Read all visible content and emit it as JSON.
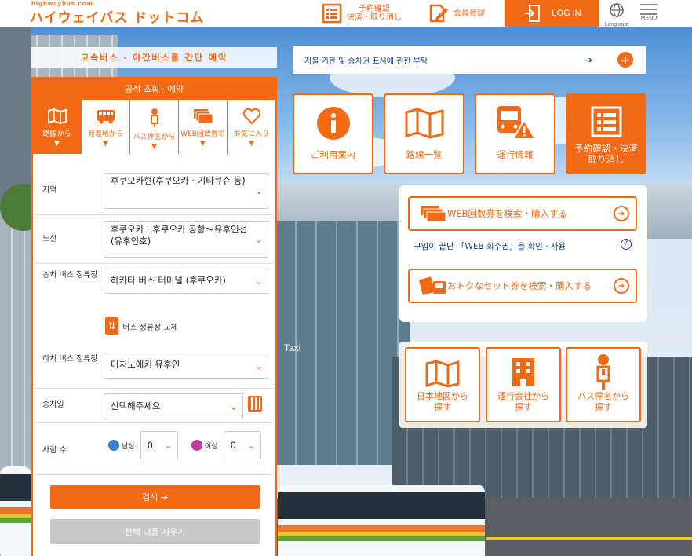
{
  "header": {
    "logo_url": "highwaybus.com",
    "logo_text": "ハイウェイバス ドットコム",
    "reservation_label_1": "予約確認",
    "reservation_label_2": "決済・取り消し",
    "member_label": "会員登録",
    "login_label": "LOG IN",
    "language_label": "Language",
    "menu_label": "MENU"
  },
  "catchphrase": "고속버스 · 야간버스를 간단 예약",
  "panel": {
    "title": "공석 조회 · 예약",
    "tabs": [
      {
        "label": "路線から",
        "icon": "map-icon",
        "active": true
      },
      {
        "label": "発着地から",
        "icon": "bus-icon",
        "active": false
      },
      {
        "label": "バス停名から",
        "icon": "bus-stop-icon",
        "active": false
      },
      {
        "label": "WEB回数券で",
        "icon": "ticket-icon",
        "active": false
      },
      {
        "label": "お気に入り",
        "icon": "heart-icon",
        "active": false
      }
    ],
    "region_label": "지역",
    "region_value": "후쿠오카현(후쿠오카 · 기타큐슈 등)",
    "route_label": "노선",
    "route_value": "후쿠오카 · 후쿠오카 공항～유후인선(유후인호)",
    "boarding_label": "승차 버스 정류장",
    "boarding_value": "하카타 버스 터미널 (후쿠오카)",
    "swap_label": "버스 정류장 교체",
    "alighting_label": "하차 버스 정류장",
    "alighting_value": "미치노에키 유후인",
    "date_label": "승차일",
    "date_placeholder": "선택해주세요",
    "people_label": "사람 수",
    "male_label": "남성",
    "male_count": "0",
    "female_label": "여성",
    "female_count": "0",
    "search_button": "검색 ➔",
    "clear_button": "선택 내용 지우기"
  },
  "notice": {
    "text": "지불 기한 및 승차권 표시에 관한 부탁",
    "arrow": "➔",
    "plus": "+"
  },
  "tiles": [
    {
      "label": "ご利用案内",
      "icon": "info-icon"
    },
    {
      "label": "路線一覧",
      "icon": "map-icon"
    },
    {
      "label": "運行情報",
      "icon": "bus-warning-icon"
    },
    {
      "label": "予約確認・決済\n取り消し",
      "icon": "list-icon"
    }
  ],
  "info_box": {
    "web_ticket_button": "WEB回数券を検索・購入する",
    "web_ticket_note": "구입이 끝난 「WEB 회수권」을 확인 · 사용",
    "set_ticket_button": "おトクなセット券を検索・購入する"
  },
  "search_from": [
    {
      "label": "日本地図から\n探す",
      "icon": "japan-map-icon"
    },
    {
      "label": "運行会社から\n探す",
      "icon": "building-icon"
    },
    {
      "label": "バス停名から\n探す",
      "icon": "bus-stop-icon"
    }
  ],
  "colors": {
    "accent": "#f26a15",
    "link": "#1a3f8a"
  }
}
